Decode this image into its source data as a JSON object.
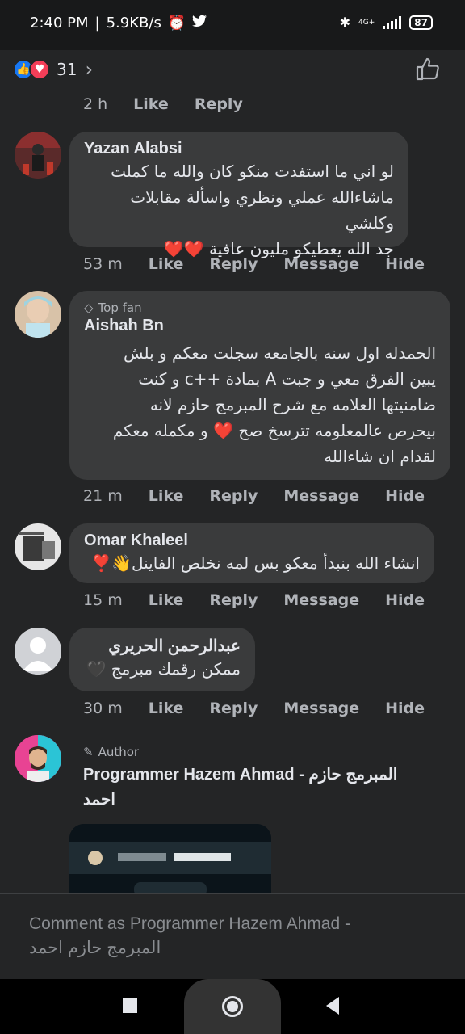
{
  "status_bar": {
    "time": "2:40 PM",
    "separator": "|",
    "speed": "5.9KB/s",
    "network": "4G+",
    "battery": "87"
  },
  "reactions": {
    "count": "31"
  },
  "first_meta": {
    "time": "2 h",
    "like": "Like",
    "reply": "Reply"
  },
  "comments": [
    {
      "author": "Yazan Alabsi",
      "lines": [
        "لو اني ما استفدت منكو كان والله ما كملت",
        "ماشاءالله عملي ونظري واسألة مقابلات وكلشي",
        "جد الله يعطيكو مليون عافية"
      ],
      "hearts": "❤️❤️",
      "time": "53 m",
      "like": "Like",
      "reply": "Reply",
      "message": "Message",
      "hide": "Hide"
    },
    {
      "badge": "Top fan",
      "author": "Aishah Bn",
      "lines": [
        "الحمدله اول سنه بالجامعه سجلت معكم و بلش",
        "يبين الفرق معي و جبت A بمادة ++c و كنت",
        "ضامنيتها العلامه مع شرح المبرمج حازم لانه",
        "بيحرص عالمعلومه تترسخ صح ❤️ و مكمله معكم",
        "لقدام ان شاءالله"
      ],
      "time": "21 m",
      "like": "Like",
      "reply": "Reply",
      "message": "Message",
      "hide": "Hide"
    },
    {
      "author": "Omar Khaleel",
      "lines": [
        "انشاء الله بنبدأ معكو بس لمه نخلص الفاينل👋❣️"
      ],
      "time": "15 m",
      "like": "Like",
      "reply": "Reply",
      "message": "Message",
      "hide": "Hide"
    },
    {
      "author": "عبدالرحمن الحريري",
      "lines": [
        "ممكن رقمك مبرمج 🖤"
      ],
      "time": "30 m",
      "like": "Like",
      "reply": "Reply",
      "message": "Message",
      "hide": "Hide"
    },
    {
      "badge": "Author",
      "author_line1": "Programmer Hazem Ahmad - المبرمج حازم",
      "author_line2": "احمد"
    }
  ],
  "composer": {
    "placeholder_line1": "Comment as Programmer Hazem Ahmad -",
    "placeholder_line2": "المبرمج حازم احمد"
  }
}
